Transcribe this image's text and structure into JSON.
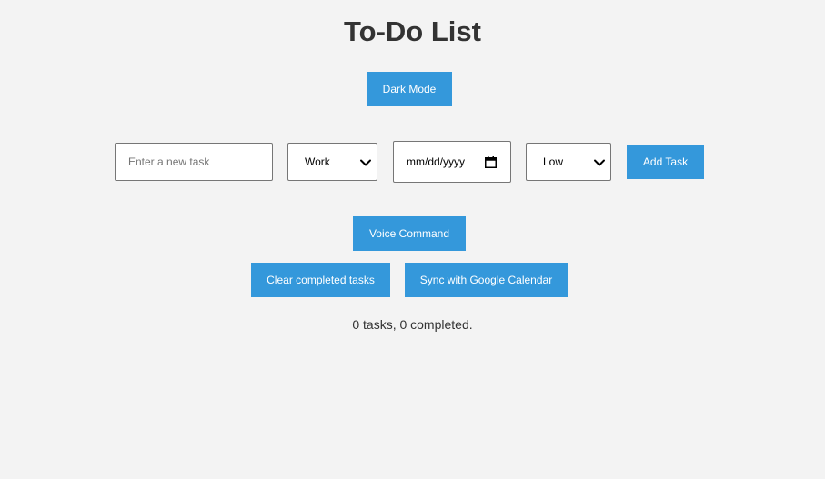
{
  "header": {
    "title": "To-Do List"
  },
  "toolbar": {
    "dark_mode_label": "Dark Mode",
    "add_task_label": "Add Task",
    "voice_command_label": "Voice Command",
    "clear_completed_label": "Clear completed tasks",
    "sync_calendar_label": "Sync with Google Calendar"
  },
  "form": {
    "task_input": {
      "value": "",
      "placeholder": "Enter a new task"
    },
    "category_select": {
      "selected": "Work",
      "icon": "chevron-down-icon"
    },
    "due_date": {
      "placeholder": "mm/dd/yyyy",
      "icon": "calendar-icon"
    },
    "priority_select": {
      "selected": "Low",
      "icon": "chevron-down-icon"
    }
  },
  "summary": {
    "status_text": "0 tasks, 0 completed."
  },
  "colors": {
    "accent": "#3498db",
    "background": "#f3f3f3",
    "text": "#333333"
  }
}
